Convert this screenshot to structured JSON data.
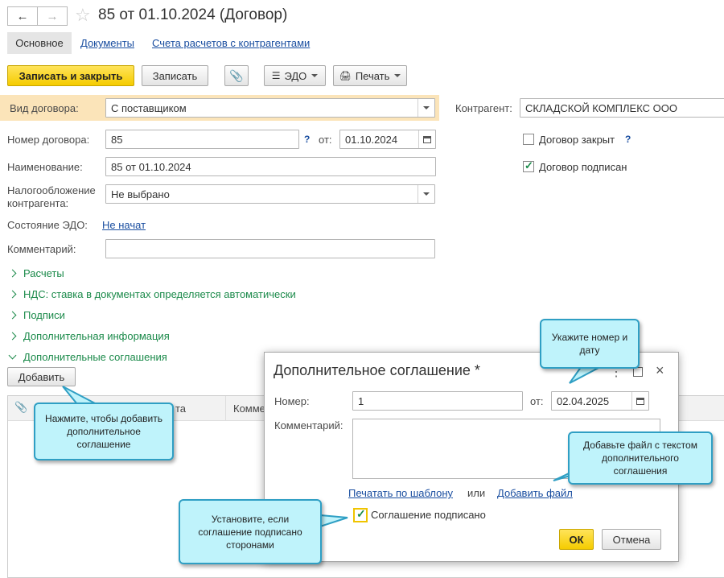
{
  "header": {
    "title": "85 от 01.10.2024 (Договор)"
  },
  "tabs": [
    "Основное",
    "Документы",
    "Счета расчетов с контрагентами"
  ],
  "toolbar": {
    "save_close": "Записать и закрыть",
    "save": "Записать",
    "edo": "ЭДО",
    "print": "Печать"
  },
  "form": {
    "contract_type_label": "Вид договора:",
    "contract_type": "С поставщиком",
    "counterparty_label": "Контрагент:",
    "counterparty": "СКЛАДСКОЙ КОМПЛЕКС ООО",
    "number_label": "Номер договора:",
    "number": "85",
    "help": "?",
    "from_label": "от:",
    "date": "01.10.2024",
    "closed_label": "Договор закрыт",
    "signed_label": "Договор подписан",
    "name_label": "Наименование:",
    "name": "85 от 01.10.2024",
    "tax_label": "Налогообложение контрагента:",
    "tax": "Не выбрано",
    "edo_state_label": "Состояние ЭДО:",
    "edo_state": "Не начат",
    "comment_label": "Комментарий:",
    "comment": ""
  },
  "groups": [
    "Расчеты",
    "НДС: ставка в документах определяется автоматически",
    "Подписи",
    "Дополнительная информация",
    "Дополнительные соглашения"
  ],
  "add_button": "Добавить",
  "table": {
    "columns": [
      "та",
      "Комме"
    ]
  },
  "dialog": {
    "title": "Дополнительное соглашение *",
    "number_label": "Номер:",
    "number": "1",
    "from_label": "от:",
    "date": "02.04.2025",
    "comment_label": "Комментарий:",
    "comment": "",
    "print_link": "Печатать по шаблону",
    "or": "или",
    "add_file_link": "Добавить файл",
    "signed_label": "Соглашение подписано",
    "ok": "ОК",
    "cancel": "Отмена"
  },
  "callouts": {
    "add": "Нажмите, чтобы добавить дополнительное соглашение",
    "number": "Укажите номер и дату",
    "file": "Добавьте файл с текстом дополнительного соглашения",
    "signed": "Установите, если соглашение подписано сторонами"
  },
  "colors": {
    "accent_yellow": "#f5cc00",
    "group_green": "#1b8a4a",
    "link_blue": "#1a4ea0",
    "callout_bg": "#bff3fb"
  }
}
